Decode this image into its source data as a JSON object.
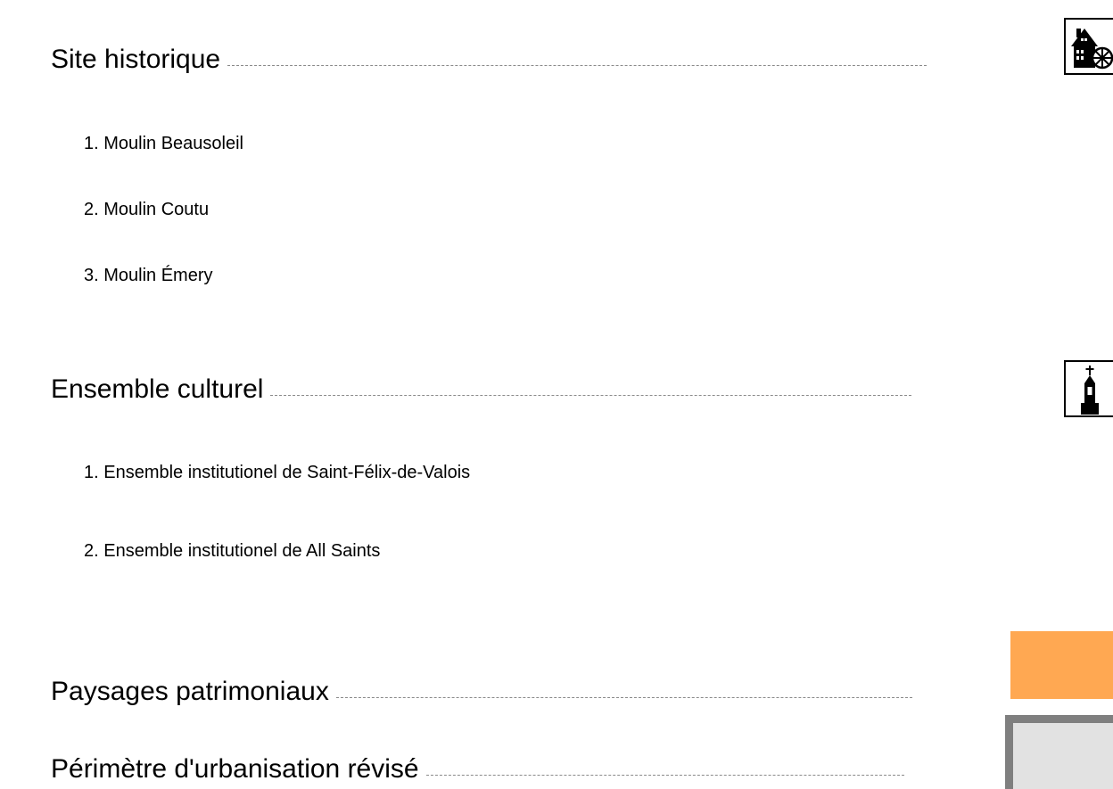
{
  "sections": [
    {
      "title": "Site historique",
      "icon": "mill-house-icon",
      "items": [
        "1. Moulin Beausoleil",
        "2. Moulin Coutu",
        "3. Moulin Émery"
      ]
    },
    {
      "title": "Ensemble culturel",
      "icon": "church-icon",
      "items": [
        "1. Ensemble institutionel de Saint-Félix-de-Valois",
        "2. Ensemble institutionel de All Saints"
      ]
    },
    {
      "title": "Paysages patrimoniaux",
      "swatch_color": "#ffa852"
    },
    {
      "title": "Périmètre d'urbanisation révisé",
      "swatch_color": "#e2e2e2",
      "swatch_border_color": "#7f7f7f"
    }
  ]
}
